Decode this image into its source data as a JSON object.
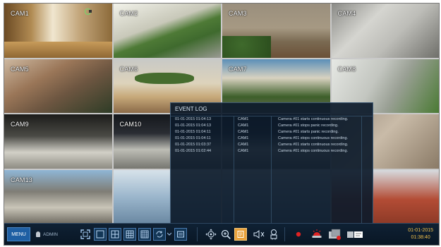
{
  "cameras": [
    {
      "label": "CAM1"
    },
    {
      "label": "CAM2"
    },
    {
      "label": "CAM3"
    },
    {
      "label": "CAM4"
    },
    {
      "label": "CAM5"
    },
    {
      "label": "CAM6"
    },
    {
      "label": "CAM7"
    },
    {
      "label": "CAM8"
    },
    {
      "label": "CAM9"
    },
    {
      "label": "CAM10"
    },
    {
      "label": ""
    },
    {
      "label": ""
    },
    {
      "label": "CAM13"
    },
    {
      "label": ""
    },
    {
      "label": ""
    },
    {
      "label": ""
    }
  ],
  "event_log": {
    "title": "EVENT LOG",
    "rows": [
      {
        "datetime": "01-01-2015  01:04:13",
        "camera": "CAM1",
        "message": "Camera #01 starts continuous recording."
      },
      {
        "datetime": "01-01-2015  01:04:13",
        "camera": "CAM1",
        "message": "Camera #01 stops panic recording."
      },
      {
        "datetime": "01-01-2015  01:04:11",
        "camera": "CAM1",
        "message": "Camera #01 starts panic recording."
      },
      {
        "datetime": "01-01-2015  01:04:11",
        "camera": "CAM1",
        "message": "Camera #01 stops continuous recording."
      },
      {
        "datetime": "01-01-2015  01:03:37",
        "camera": "CAM1",
        "message": "Camera #01 starts continuous recording."
      },
      {
        "datetime": "01-01-2015  01:02:44",
        "camera": "CAM1",
        "message": "Camera #01 stops continuous recording."
      }
    ]
  },
  "toolbar": {
    "menu_label": "MENU",
    "user_label": "ADMIN",
    "date": "01-01-2015",
    "time": "01:38:40",
    "accent_color": "#f2c14a",
    "record_color": "#e02222",
    "icons": [
      "fullscreen-icon",
      "single-layout-icon",
      "quad-layout-icon",
      "nine-layout-icon",
      "sixteen-layout-icon",
      "sequence-icon",
      "dropdown-icon",
      "ptz-icon",
      "zoom-icon",
      "freeze-icon",
      "audio-icon",
      "alarm-icon",
      "record-icon",
      "panic-record-icon",
      "playback-icon",
      "search-icon"
    ]
  }
}
